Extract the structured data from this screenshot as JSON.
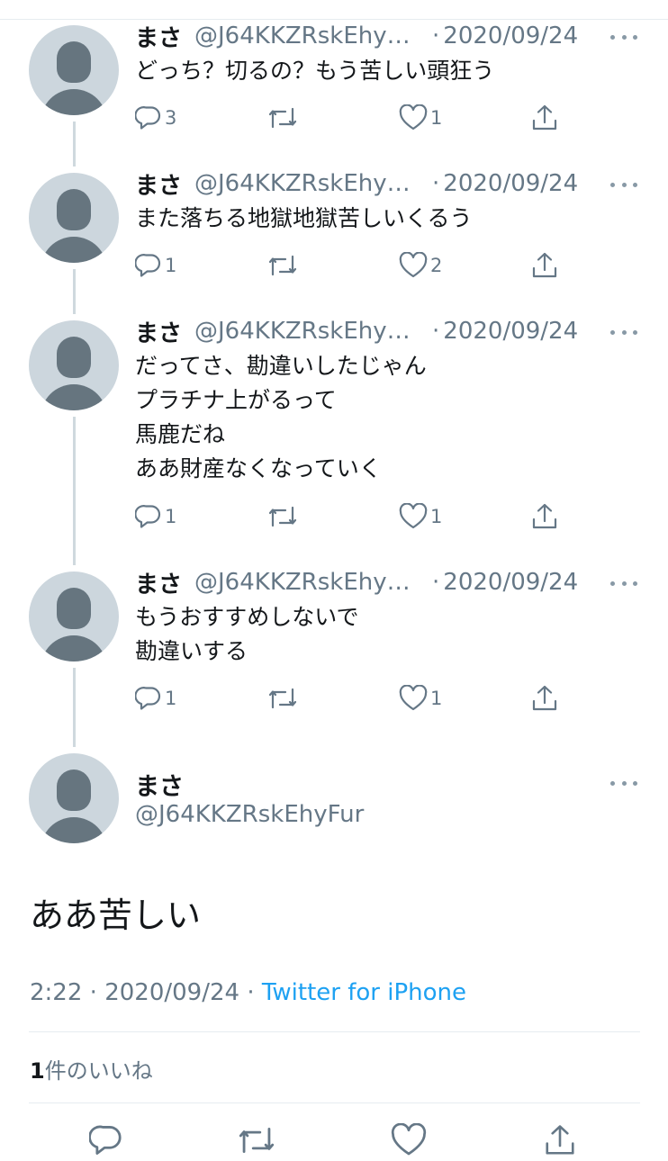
{
  "tweets": [
    {
      "name": "まさ",
      "handle": "@J64KKZRskEhyFur",
      "handle_display": "@J64KKZRskEhy…",
      "dot": "·",
      "date": "2020/09/24",
      "lines": [
        "どっち？切るの？もう苦しい頭狂う"
      ],
      "reply_count": "3",
      "retweet_count": "",
      "like_count": "1"
    },
    {
      "name": "まさ",
      "handle": "@J64KKZRskEhyFur",
      "handle_display": "@J64KKZRskEhy…",
      "dot": "·",
      "date": "2020/09/24",
      "lines": [
        "また落ちる地獄地獄苦しいくるう"
      ],
      "reply_count": "1",
      "retweet_count": "",
      "like_count": "2"
    },
    {
      "name": "まさ",
      "handle": "@J64KKZRskEhyFur",
      "handle_display": "@J64KKZRskEhy…",
      "dot": "·",
      "date": "2020/09/24",
      "lines": [
        "だってさ、勘違いしたじゃん",
        "プラチナ上がるって",
        "馬鹿だね",
        "ああ財産なくなっていく"
      ],
      "reply_count": "1",
      "retweet_count": "",
      "like_count": "1"
    },
    {
      "name": "まさ",
      "handle": "@J64KKZRskEhyFur",
      "handle_display": "@J64KKZRskEhy…",
      "dot": "·",
      "date": "2020/09/24",
      "lines": [
        "もうおすすめしないで",
        "勘違いする"
      ],
      "reply_count": "1",
      "retweet_count": "",
      "like_count": "1"
    }
  ],
  "main_tweet": {
    "name": "まさ",
    "handle": "@J64KKZRskEhyFur",
    "text": "ああ苦しい",
    "time": "2:22",
    "separator": "·",
    "date": "2020/09/24",
    "source": "Twitter for iPhone",
    "likes_count": "1",
    "likes_label": "件のいいね"
  },
  "icons": {
    "reply": "reply-icon",
    "retweet": "retweet-icon",
    "like": "heart-icon",
    "share": "share-icon",
    "more": "more-icon",
    "avatar": "default-avatar"
  },
  "colors": {
    "text": "#14171a",
    "secondary": "#657786",
    "link": "#1da1f2",
    "avatar_bg": "#ccd6dd",
    "avatar_fg": "#66757f",
    "divider": "#e6ecf0"
  }
}
